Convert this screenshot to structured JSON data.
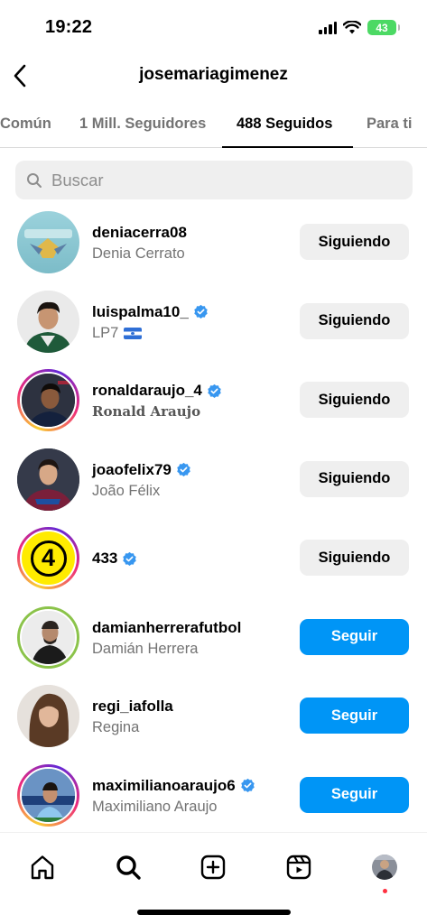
{
  "status_bar": {
    "time": "19:22",
    "battery": "43"
  },
  "header": {
    "title": "josemariagimenez"
  },
  "tabs": [
    {
      "label": "Común"
    },
    {
      "label": "1 Mill. Seguidores"
    },
    {
      "label": "488 Seguidos",
      "active": true
    },
    {
      "label": "Para ti"
    }
  ],
  "search": {
    "placeholder": "Buscar"
  },
  "users": [
    {
      "username": "deniacerra08",
      "name": "Denia Cerrato",
      "verified": false,
      "button": "Siguiendo"
    },
    {
      "username": "luispalma10_",
      "name": "LP7",
      "verified": true,
      "button": "Siguiendo"
    },
    {
      "username": "ronaldaraujo_4",
      "name": "Ronald Araujo",
      "verified": true,
      "button": "Siguiendo"
    },
    {
      "username": "joaofelix79",
      "name": "João Félix",
      "verified": true,
      "button": "Siguiendo"
    },
    {
      "username": "433",
      "name": "",
      "verified": true,
      "button": "Siguiendo",
      "avatar_text": "4"
    },
    {
      "username": "damianherrerafutbol",
      "name": "Damián Herrera",
      "verified": false,
      "button": "Seguir"
    },
    {
      "username": "regi_iafolla",
      "name": "Regina",
      "verified": false,
      "button": "Seguir"
    },
    {
      "username": "maximilianoaraujo6",
      "name": "Maximiliano Araujo",
      "verified": true,
      "button": "Seguir"
    }
  ],
  "colors": {
    "accent": "#0095f6",
    "verified": "#3897f0",
    "secondary_text": "#737373"
  },
  "nav": [
    "home-icon",
    "search-icon",
    "create-icon",
    "reels-icon",
    "profile-icon"
  ]
}
